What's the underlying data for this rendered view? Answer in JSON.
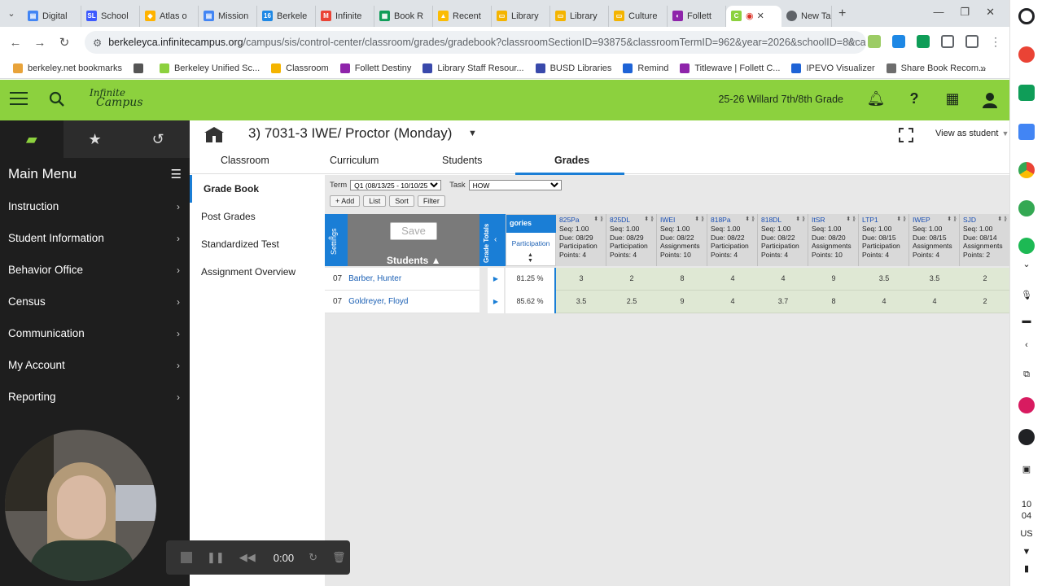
{
  "browser": {
    "tabs": [
      {
        "label": "Digital",
        "color": "#4285f4",
        "glyph": "▤"
      },
      {
        "label": "School",
        "color": "#3d5afe",
        "glyph": "SL"
      },
      {
        "label": "Atlas o",
        "color": "#ffb300",
        "glyph": "◆"
      },
      {
        "label": "Mission",
        "color": "#4285f4",
        "glyph": "▤"
      },
      {
        "label": "Berkele",
        "color": "#1e88e5",
        "glyph": "16"
      },
      {
        "label": "Infinite",
        "color": "#ea4335",
        "glyph": "M"
      },
      {
        "label": "Book R",
        "color": "#0f9d58",
        "glyph": "▦"
      },
      {
        "label": "Recent",
        "color": "#fbbc04",
        "glyph": "▲"
      },
      {
        "label": "Library",
        "color": "#f4b400",
        "glyph": "▭"
      },
      {
        "label": "Library",
        "color": "#f4b400",
        "glyph": "▭"
      },
      {
        "label": "Culture",
        "color": "#f4b400",
        "glyph": "▭"
      },
      {
        "label": "Follett",
        "color": "#8e24aa",
        "glyph": "◐"
      }
    ],
    "active_tab": {
      "label": "",
      "color": "#8cd13e",
      "glyph": "C"
    },
    "new_tab_label": "New Ta",
    "url_host": "berkeleyca.infinitecampus.org",
    "url_path": "/campus/sis/control-center/classroom/grades/gradebook?classroomSectionID=93875&classroomTermID=962&year=2026&schoolID=8&cale..."
  },
  "bookmarks": [
    {
      "label": "berkeley.net bookmarks",
      "color": "#e8a33a"
    },
    {
      "label": "",
      "color": "#555555"
    },
    {
      "label": "Berkeley Unified Sc...",
      "color": "#8cd13e"
    },
    {
      "label": "Classroom",
      "color": "#f4b400"
    },
    {
      "label": "Follett Destiny",
      "color": "#8e24aa"
    },
    {
      "label": "Library Staff Resour...",
      "color": "#3949ab"
    },
    {
      "label": "BUSD Libraries",
      "color": "#3949ab"
    },
    {
      "label": "Remind",
      "color": "#1e63d6"
    },
    {
      "label": "Titlewave | Follett C...",
      "color": "#8e24aa"
    },
    {
      "label": "IPEVO Visualizer",
      "color": "#1e63d6"
    },
    {
      "label": "Share Book Recom...",
      "color": "#6d6d6d"
    }
  ],
  "app": {
    "logo_line1": "Infinite",
    "logo_line2": "Campus",
    "school_year": "25-26 Willard 7th/8th Grade",
    "accent": "#8cd13e"
  },
  "leftmenu": {
    "title": "Main Menu",
    "items": [
      "Instruction",
      "Student Information",
      "Behavior Office",
      "Census",
      "Communication",
      "My Account",
      "Reporting"
    ]
  },
  "recorder": {
    "time": "0:00"
  },
  "section": {
    "title": "3) 7031-3 IWE/ Proctor (Monday)",
    "view_as": "View as student",
    "tabs": [
      "Classroom",
      "Curriculum",
      "Students",
      "Grades"
    ],
    "selected_tab": "Grades"
  },
  "subnav": {
    "items": [
      "Grade Book",
      "Post Grades",
      "Standardized Test",
      "Assignment Overview"
    ]
  },
  "gradebook": {
    "term_label": "Term",
    "term_value": "Q1 (08/13/25 - 10/10/25)",
    "task_label": "Task",
    "task_value": "HOW",
    "buttons": [
      "+ Add",
      "List",
      "Sort",
      "Filter"
    ],
    "settings_label": "Settings",
    "save_label": "Save",
    "students_label": "Students ▲",
    "grade_totals_label": "Grade Totals",
    "categories_label": "gories",
    "category_name": "Participation",
    "assignments": [
      {
        "name": "825Pa",
        "seq": "Seq: 1.00",
        "due": "Due: 08/29",
        "type": "Participation",
        "points": "Points: 4"
      },
      {
        "name": "825DL",
        "seq": "Seq: 1.00",
        "due": "Due: 08/29",
        "type": "Participation",
        "points": "Points: 4"
      },
      {
        "name": "IWEI",
        "seq": "Seq: 1.00",
        "due": "Due: 08/22",
        "type": "Assignments",
        "points": "Points: 10"
      },
      {
        "name": "818Pa",
        "seq": "Seq: 1.00",
        "due": "Due: 08/22",
        "type": "Participation",
        "points": "Points: 4"
      },
      {
        "name": "818DL",
        "seq": "Seq: 1.00",
        "due": "Due: 08/22",
        "type": "Participation",
        "points": "Points: 4"
      },
      {
        "name": "ItSR",
        "seq": "Seq: 1.00",
        "due": "Due: 08/20",
        "type": "Assignments",
        "points": "Points: 10"
      },
      {
        "name": "LTP1",
        "seq": "Seq: 1.00",
        "due": "Due: 08/15",
        "type": "Participation",
        "points": "Points: 4"
      },
      {
        "name": "IWEP",
        "seq": "Seq: 1.00",
        "due": "Due: 08/15",
        "type": "Assignments",
        "points": "Points: 4"
      },
      {
        "name": "SJD",
        "seq": "Seq: 1.00",
        "due": "Due: 08/14",
        "type": "Assignments",
        "points": "Points: 2"
      }
    ],
    "students": [
      {
        "grade": "07",
        "name": "Barber, Hunter",
        "percent": "81.25 %",
        "scores": [
          "3",
          "2",
          "8",
          "4",
          "4",
          "9",
          "3.5",
          "3.5",
          "2"
        ]
      },
      {
        "grade": "07",
        "name": "Goldreyer, Floyd",
        "percent": "85.62 %",
        "scores": [
          "3.5",
          "2.5",
          "9",
          "4",
          "3.7",
          "8",
          "4",
          "4",
          "2"
        ]
      }
    ]
  },
  "shelf": {
    "date_day": "10",
    "date_month": "04",
    "locale": "US"
  }
}
